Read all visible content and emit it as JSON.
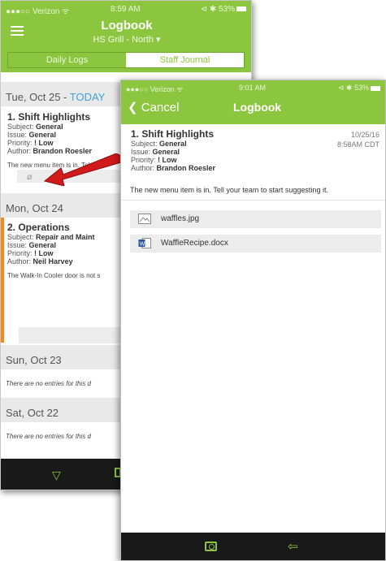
{
  "back": {
    "status": {
      "carrier": "●●●○○ Verizon ᯤ",
      "time": "8:59 AM",
      "battery": "⊲ ✱ 53%"
    },
    "header": {
      "title": "Logbook",
      "subtitle": "HS Grill - North ▾"
    },
    "tabs": {
      "daily_logs": "Daily Logs",
      "staff_journal": "Staff Journal"
    },
    "days": [
      {
        "label": "Tue, Oct 25 - ",
        "today": "TODAY"
      },
      {
        "label": "Mon, Oct 24"
      },
      {
        "label": "Sun, Oct 23"
      },
      {
        "label": "Sat, Oct 22"
      }
    ],
    "entries": [
      {
        "title": "1. Shift Highlights",
        "subject_label": "Subject:",
        "subject": "General",
        "issue_label": "Issue:",
        "issue": "General",
        "priority_label": "Priority:",
        "priority": "! Low",
        "author_label": "Author:",
        "author": "Brandon Roesler",
        "body": "The new menu item is in. Tel"
      },
      {
        "title": "2. Operations",
        "subject_label": "Subject:",
        "subject": "Repair and Maint",
        "issue_label": "Issue:",
        "issue": "General",
        "priority_label": "Priority:",
        "priority": "! Low",
        "author_label": "Author:",
        "author": "Neil Harvey",
        "body": "The Walk-In Cooler door is not s"
      }
    ],
    "no_entries": "There are no entries for this d",
    "footer_icons": [
      "filter-icon",
      "calendar-icon"
    ]
  },
  "front": {
    "status": {
      "carrier": "●●●○○ Verizon ᯤ",
      "time": "9:01 AM",
      "battery": "⊲ ✱ 53%"
    },
    "header": {
      "cancel": "❮ Cancel",
      "title": "Logbook"
    },
    "entry": {
      "title": "1. Shift Highlights",
      "subject_label": "Subject:",
      "subject": "General",
      "issue_label": "Issue:",
      "issue": "General",
      "priority_label": "Priority:",
      "priority": "! Low",
      "author_label": "Author:",
      "author": "Brandon Roesler",
      "date": "10/25/16",
      "time": "8:58AM CDT",
      "body": "The new menu item is in.  Tell your team to start suggesting it."
    },
    "attachments": [
      {
        "name": "waffles.jpg",
        "icon": "image-file-icon"
      },
      {
        "name": "WaffleRecipe.docx",
        "icon": "word-file-icon"
      }
    ],
    "footer_icons": [
      "eye-icon",
      "reply-icon"
    ]
  },
  "colors": {
    "brand_green": "#8cc63f",
    "today_blue": "#3fa2d8",
    "accent_orange": "#f18a21",
    "annotation_red": "#d11a1a",
    "footer": "#191919"
  }
}
